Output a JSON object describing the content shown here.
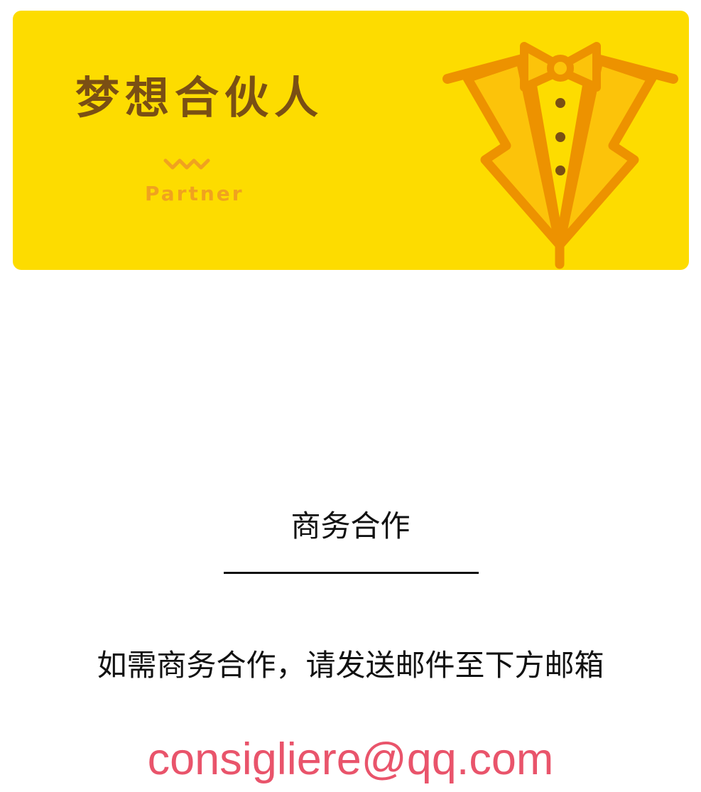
{
  "banner": {
    "title": "梦想合伙人",
    "subtitle": "Partner",
    "illustration_icon": "tuxedo-icon",
    "background_color": "#fddc00",
    "title_color": "#7a4f14",
    "accent_color": "#f0a21f"
  },
  "content": {
    "heading": "商务合作",
    "instruction": "如需商务合作，请发送邮件至下方邮箱",
    "email": "consigliere@qq.com",
    "email_color": "#e9546b"
  }
}
